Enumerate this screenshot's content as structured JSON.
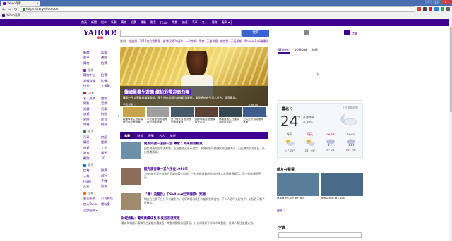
{
  "browser": {
    "tab_title": "Yahoo奇摩",
    "tab_close": "×",
    "url": "https://tw.yahoo.com",
    "bookmark": "Yahoo奇摩",
    "back": "←",
    "forward": "→",
    "reload": "↻",
    "star": "☆",
    "win_min": "–",
    "win_max": "□",
    "win_close": "✕"
  },
  "yahoo_nav": {
    "items": [
      "首頁",
      "新聞",
      "股市",
      "氣象",
      "購物",
      "拍賣",
      "運動",
      "影音",
      "Flickr",
      "電影",
      "旅遊",
      "汽車",
      "名人",
      "理財"
    ],
    "more": "更多 ▾"
  },
  "header": {
    "logo": "YAHOO!",
    "logo_sub": "奇摩",
    "search_button": "搜尋",
    "mail_label": "信箱"
  },
  "trending": {
    "label": "熱門:",
    "items": [
      "金曲獎",
      "2017台北電影節",
      "香港回歸20週年",
      "一代宗師",
      "電商",
      "王者榮耀",
      "麥當勞",
      "天氣預報",
      "IPhone 8 新機曝光"
    ]
  },
  "sidebar": {
    "top": [
      [
        "新聞",
        "氣象"
      ],
      [
        "股市",
        "運動"
      ],
      [
        "購物",
        "拍賣"
      ]
    ],
    "sections": [
      {
        "title": "服務",
        "color": "#7b1fa2",
        "rows": [
          [
            "購物中心",
            "拍賣"
          ],
          [
            "超級商城",
            "比價"
          ],
          [
            "拼拍",
            "大量購"
          ]
        ]
      },
      {
        "title": "FUN",
        "color": "#d0021b",
        "rows": [
          [
            "名人娛樂",
            "電影"
          ],
          [
            "電影",
            "音樂"
          ],
          [
            "遊戲",
            "汽車"
          ],
          [
            "旅遊",
            "時尚"
          ],
          [
            "星座",
            "影音"
          ],
          [
            "電視",
            "網誌"
          ]
        ]
      },
      {
        "title": "生活",
        "color": "#2e7d32",
        "rows": [
          [
            "汽車",
            "房屋"
          ],
          [
            "購屋",
            "健康"
          ],
          [
            "旅遊",
            "工作"
          ],
          [
            "美食",
            "電子"
          ],
          [
            "醫院",
            "3C"
          ]
        ]
      },
      {
        "title": "實用",
        "color": "#1565c0",
        "rows": [
          [
            "信箱",
            "翻譯"
          ],
          [
            "字典",
            "ATM"
          ],
          [
            "Flickr",
            "手機"
          ],
          [
            "天氣",
            "股票"
          ]
        ]
      },
      {
        "title": "企業",
        "color": "#ef6c00",
        "rows": [
          [
            "廣告服務",
            "公司資訊"
          ],
          [
            "加入Yahoo",
            "隱私權"
          ]
        ]
      }
    ],
    "all_services": "全部服務 ▸"
  },
  "hero": {
    "title": "韓國畢業生遊園 繽紛彩帶迎面飛舞",
    "summary": "韓國一所大學舉辦畢業典禮，學生們在校園內施放彩帶慶祝，畫面繽紛吸引眾人目光，場面歡樂。",
    "more": "更多圖輯 ›",
    "pager": "1 of 10"
  },
  "thumbs": [
    {
      "caption": "韓國畢業生遊園 繽紛彩帶迎面飛舞",
      "color": "#c7a34a"
    },
    {
      "caption": "中元普渡 全台各地祭祀活動熱鬧",
      "color": "#9e9e9e"
    },
    {
      "caption": "夏日煙火秀 點亮夜空絢麗奪目",
      "color": "#455a64"
    },
    {
      "caption": "國際時裝週 各國模特兒走秀",
      "color": "#5d4037"
    },
    {
      "caption": "熊貓寶寶生日 動物園慶祝活動",
      "color": "#37474f"
    },
    {
      "caption": "天氣炎熱 民眾戲水消暑",
      "color": "#3e5e8e"
    }
  ],
  "news_tabs": [
    "焦點",
    "財經",
    "運動",
    "名人",
    "旅遊"
  ],
  "stories": [
    {
      "title": "颱風外圍一波接一波 專家：再來兩個颱風",
      "body": "由於颱風外圍環流影響，全台各地天氣不穩定，中央氣象局提醒民眾注意大雨，山區須防坍方落石，外出攜帶雨具。",
      "color": "#6d8fa8"
    },
    {
      "title": "聽完課音樂一堂人生在1980年",
      "body": "1980年代是台灣流行音樂的黃金時期，一首首經典歌曲陪伴許多人走過青春歲月，至今仍被傳唱不已。",
      "color": "#8c6d5a"
    },
    {
      "title": "「機！流量告」千Call out回到國際：笑翻",
      "body": "網友在社群平台分享有趣影片，短短時間內吸引大量轉發與留言，不少人直呼太好笑了，紛紛表示看了好幾次。",
      "color": "#a08a6e"
    },
    {
      "title": "財經焦點：電商業績成長 科技股表現亮眼",
      "body": "最新財報顯示電商平台業績持續成長，帶動相關科技股表現，分析師看好下半年市場動能，投資人關注後續走勢。",
      "color": ""
    }
  ],
  "right": {
    "tabs": [
      "購物中心",
      "超級商城",
      "拍賣"
    ],
    "weather": {
      "city": "臺北 ⚲",
      "meta": "上次更新時間 ·",
      "temp": "24",
      "unit": "°C",
      "desc": "多雲時晴",
      "rain": "☂ 29%",
      "forecast": [
        {
          "day": "今天",
          "lo": "24°",
          "hi": "29°",
          "red": false
        },
        {
          "day": "明天",
          "lo": "24°",
          "hi": "29°",
          "red": true
        },
        {
          "day": "06/04",
          "lo": "20°",
          "hi": "24°",
          "red": true
        },
        {
          "day": "06/05",
          "lo": "19°",
          "hi": "24°",
          "red": false
        }
      ]
    },
    "explore_title": "網友在看看",
    "explore": [
      {
        "caption": "熊貓寶寶人氣旺 圓仔家族",
        "color": "#5a7e9a"
      },
      {
        "caption": "萌獸搶鏡頭 網友笑翻",
        "color": "#4a6a8a"
      }
    ],
    "more": "更多 ›",
    "dict_label": "字典"
  }
}
